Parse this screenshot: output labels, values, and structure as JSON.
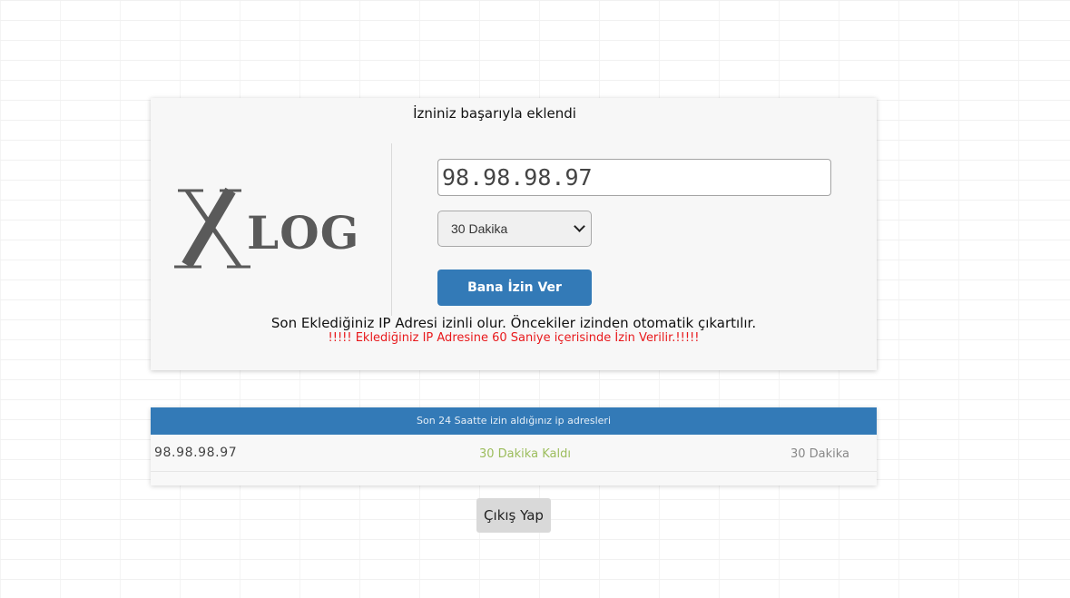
{
  "status": {
    "success_message": "İzniniz başarıyla eklendi"
  },
  "logo": {
    "text": "XLOG"
  },
  "form": {
    "ip_value": "98.98.98.97",
    "duration_selected": "30 Dakika",
    "submit_label": "Bana İzin Ver"
  },
  "notes": {
    "info": "Son Eklediğiniz IP Adresi izinli olur. Öncekiler izinden otomatik çıkartılır.",
    "warning": "!!!!! Eklediğiniz IP Adresine 60 Saniye içerisinde İzin Verilir.!!!!!"
  },
  "history": {
    "header": "Son 24 Saatte izin aldığınız ip adresleri",
    "rows": [
      {
        "ip": "98.98.98.97",
        "remaining": "30 Dakika Kaldı",
        "duration": "30 Dakika"
      }
    ]
  },
  "actions": {
    "logout_label": "Çıkış Yap"
  },
  "colors": {
    "primary": "#337ab7",
    "warning": "#e8191c",
    "remaining": "#9cbd5d",
    "logo": "#5a5a5a"
  }
}
